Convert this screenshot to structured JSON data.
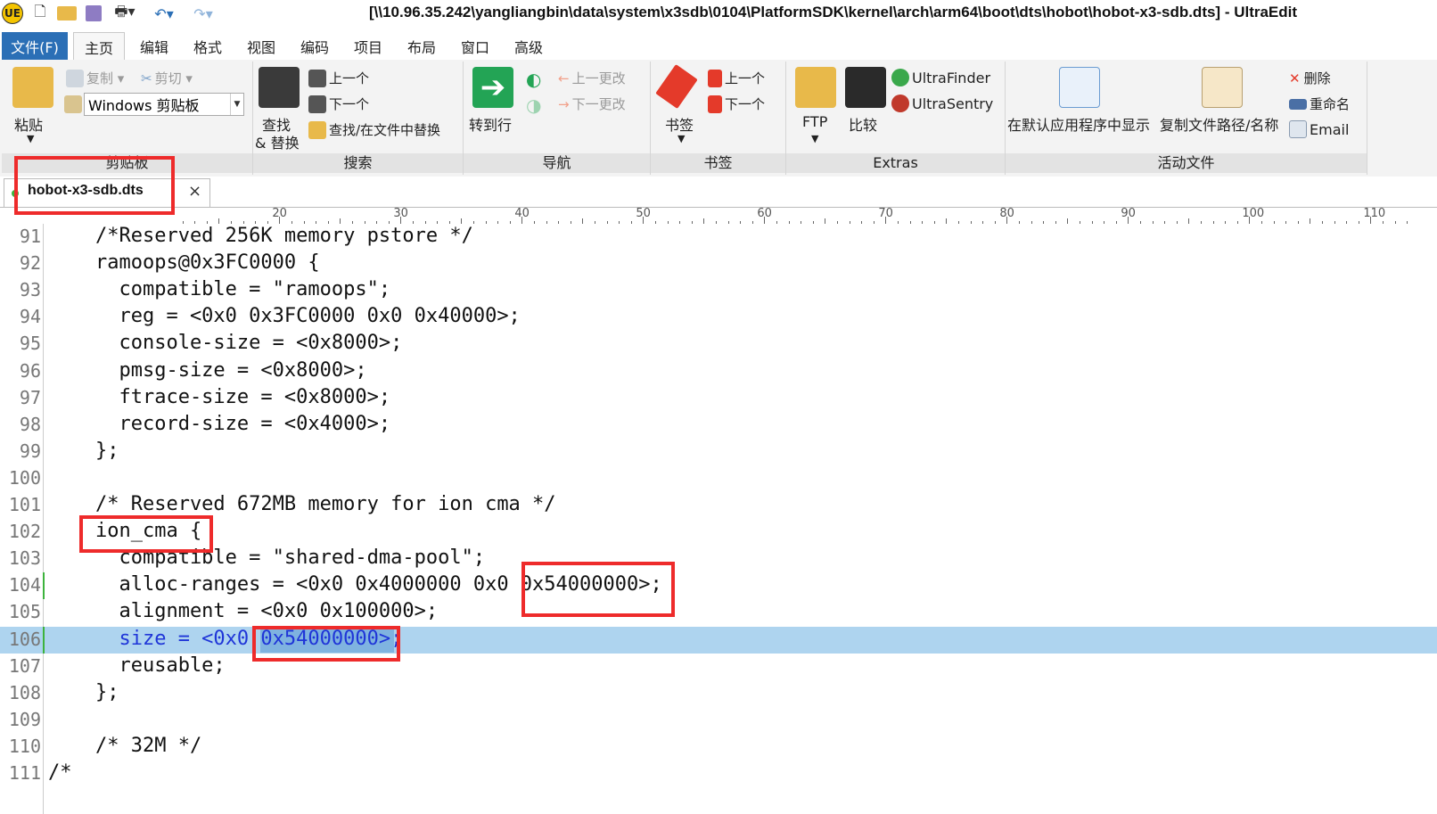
{
  "titlebar": {
    "title": "[\\\\10.96.35.242\\yangliangbin\\data\\system\\x3sdb\\0104\\PlatformSDK\\kernel\\arch\\arm64\\boot\\dts\\hobot\\hobot-x3-sdb.dts] - UltraEdit",
    "logo_letter": "UE"
  },
  "menubar": {
    "file": "文件(F)",
    "tabs": [
      "主页",
      "编辑",
      "格式",
      "视图",
      "编码",
      "项目",
      "布局",
      "窗口",
      "高级"
    ]
  },
  "ribbon": {
    "clipboard": {
      "paste": "粘贴",
      "copy": "复制",
      "cut": "剪切",
      "clipboard_select": "Windows 剪贴板",
      "label": "剪贴板"
    },
    "search": {
      "find_replace": "查找",
      "find_replace2": "& 替换",
      "prev": "上一个",
      "next": "下一个",
      "find_in_files": "查找/在文件中替换",
      "label": "搜索"
    },
    "navigation": {
      "goto": "转到行",
      "prev_change": "上一更改",
      "next_change": "下一更改",
      "label": "导航"
    },
    "bookmarks": {
      "bookmark": "书签",
      "prev": "上一个",
      "next": "下一个",
      "label": "书签"
    },
    "extras": {
      "ftp": "FTP",
      "compare": "比较",
      "ultrafinder": "UltraFinder",
      "ultrasentry": "UltraSentry",
      "label": "Extras"
    },
    "active_file": {
      "show_default": "在默认应用程序中显示",
      "copy_path": "复制文件路径/名称",
      "delete": "删除",
      "rename": "重命名",
      "email": "Email",
      "label": "活动文件"
    }
  },
  "file_tab": {
    "name": "hobot-x3-sdb.dts",
    "close": "×"
  },
  "ruler": [
    "20",
    "30",
    "40",
    "50",
    "60",
    "70",
    "80",
    "90",
    "100",
    "110"
  ],
  "lines": [
    {
      "n": "91",
      "code": "    /*Reserved 256K memory pstore */"
    },
    {
      "n": "92",
      "code": "    ramoops@0x3FC0000 {"
    },
    {
      "n": "93",
      "code": "      compatible = \"ramoops\";"
    },
    {
      "n": "94",
      "code": "      reg = <0x0 0x3FC0000 0x0 0x40000>;"
    },
    {
      "n": "95",
      "code": "      console-size = <0x8000>;"
    },
    {
      "n": "96",
      "code": "      pmsg-size = <0x8000>;"
    },
    {
      "n": "97",
      "code": "      ftrace-size = <0x8000>;"
    },
    {
      "n": "98",
      "code": "      record-size = <0x4000>;"
    },
    {
      "n": "99",
      "code": "    };"
    },
    {
      "n": "100",
      "code": ""
    },
    {
      "n": "101",
      "code": "    /* Reserved 672MB memory for ion cma */"
    },
    {
      "n": "102",
      "code": "    ion_cma {"
    },
    {
      "n": "103",
      "code": "      compatible = \"shared-dma-pool\";"
    },
    {
      "n": "104",
      "code": "      alloc-ranges = <0x0 0x4000000 0x0 0x54000000>;"
    },
    {
      "n": "105",
      "code": "      alignment = <0x0 0x100000>;"
    },
    {
      "n": "106",
      "code": "      size = <0x0 0x54000000>;"
    },
    {
      "n": "107",
      "code": "      reusable;"
    },
    {
      "n": "108",
      "code": "    };"
    },
    {
      "n": "109",
      "code": ""
    },
    {
      "n": "110",
      "code": "    /* 32M */"
    },
    {
      "n": "111",
      "code": "/*"
    }
  ],
  "colors": {
    "accent": "#2b6fb6",
    "highlight_line": "#aed4ef",
    "highlight_text": "#1f35d8",
    "annotation_red": "#ee2b2b",
    "modified_marker": "#3db33d"
  }
}
